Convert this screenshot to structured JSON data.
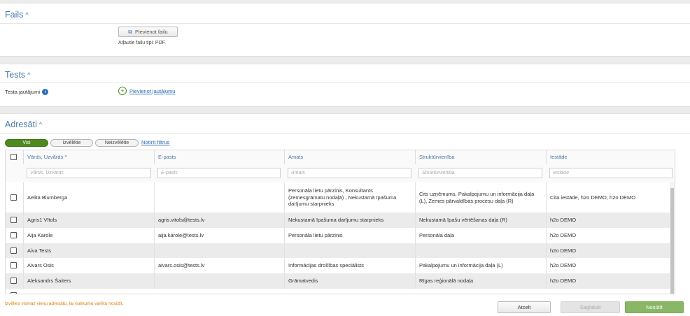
{
  "files": {
    "title": "Fails",
    "add_button": "Pievienot failu",
    "allowed_types": "Atļautie failu tipi: PDF."
  },
  "test": {
    "title": "Tests",
    "questions_label": "Testa jautājumi",
    "add_question_link": "Pievienot jautājumu"
  },
  "recipients": {
    "title": "Adresāti",
    "filters": {
      "all": "Visi",
      "selected": "Izvēlētie",
      "unselected": "Neizvēlētie",
      "clear": "Notīrīt filtrus"
    },
    "columns": [
      {
        "label": "Vārds, Uzvārds ^",
        "placeholder": "Vārds, Uzvārds"
      },
      {
        "label": "E-pasts",
        "placeholder": "E-pasts"
      },
      {
        "label": "Amats",
        "placeholder": "Amats"
      },
      {
        "label": "Struktūrvienība",
        "placeholder": "Struktūrvienība"
      },
      {
        "label": "Iestāde",
        "placeholder": "Iestāde"
      }
    ],
    "rows": [
      {
        "name": "Aelita Blumberga",
        "email": "",
        "position": "Personāla lietu pārzinis, Konsultants (zemesgrāmatu nodaļā) , Nekustamā īpašuma darījumu starpnieks",
        "unit": "Cits uzņēmums, Pakalpojumu un informācija daļa (L), Zemes pārvaldības procesu daļa (R)",
        "institution": "Cita iestāde, h2o DEMO, h2o DEMO"
      },
      {
        "name": "Agris1 Vītols",
        "email": "agris.vitols@tests.lv",
        "position": "Nekustamā īpašuma darījumu starpnieks",
        "unit": "Nekustamā īpašu vērtēšanas daļa (R)",
        "institution": "h2o DEMO"
      },
      {
        "name": "Aija Karole",
        "email": "aija.karole@tests.lv",
        "position": "Personāla lietu pārzinis",
        "unit": "Personāla daļa",
        "institution": "h2o DEMO"
      },
      {
        "name": "Aiva Tests",
        "email": "",
        "position": "",
        "unit": "",
        "institution": "h2o DEMO"
      },
      {
        "name": "Aivars Osis",
        "email": "aivars.osis@tests.lv",
        "position": "Informācijas drošības speciālists",
        "unit": "Pakalpojumu un informācija daļa (L)",
        "institution": "h2o DEMO"
      },
      {
        "name": "Aleksandrs Šaiters",
        "email": "",
        "position": "Grāmatvedis",
        "unit": "Rīgas reģionālā nodaļa",
        "institution": "h2o DEMO"
      }
    ]
  },
  "footer": {
    "warning": "Izvēlies vismaz vienu adresātu, lai notikumu varētu nosūtīt.",
    "cancel": "Atcelt",
    "save": "Saglabāt",
    "send": "Nosūtīt"
  },
  "colors": {
    "accent": "#4a79a8",
    "active_filter": "#4f8a1f",
    "send_button": "#8ab765",
    "warning": "#e07b00"
  }
}
